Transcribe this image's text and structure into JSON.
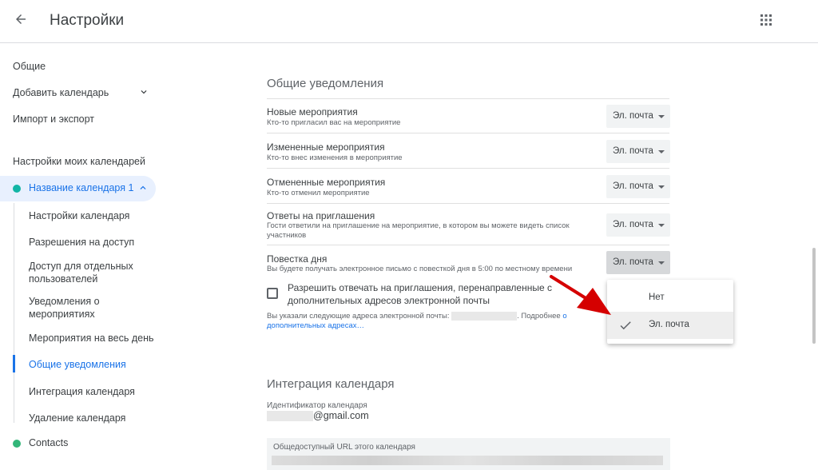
{
  "colors": {
    "accent": "#1a73e8",
    "calendar_dot": "#12b5a5",
    "contacts_dot": "#33b679",
    "annotation_arrow": "#d50000"
  },
  "header": {
    "title": "Настройки",
    "back_icon": "arrow-back-icon",
    "apps_icon": "apps-grid-icon"
  },
  "sidebar": {
    "general": "Общие",
    "add_calendar": "Добавить календарь",
    "import_export": "Импорт и экспорт",
    "my_calendars_heading": "Настройки моих календарей",
    "calendar_name": "Название календаря 1",
    "sub_items": [
      "Настройки календаря",
      "Разрешения на доступ",
      "Доступ для отдельных пользователей",
      "Уведомления о мероприятиях",
      "Мероприятия на весь день",
      "Общие уведомления",
      "Интеграция календаря",
      "Удаление календаря"
    ],
    "active_sub_item": "Общие уведомления",
    "contacts": "Contacts"
  },
  "notifications": {
    "section_title": "Общие уведомления",
    "rows": [
      {
        "title": "Новые мероприятия",
        "subtitle": "Кто-то пригласил вас на мероприятие",
        "value": "Эл. почта"
      },
      {
        "title": "Измененные мероприятия",
        "subtitle": "Кто-то внес изменения в мероприятие",
        "value": "Эл. почта"
      },
      {
        "title": "Отмененные мероприятия",
        "subtitle": "Кто-то отменил мероприятие",
        "value": "Эл. почта"
      },
      {
        "title": "Ответы на приглашения",
        "subtitle": "Гости ответили на приглашение на мероприятие, в котором вы можете видеть список участников",
        "value": "Эл. почта"
      },
      {
        "title": "Повестка дня",
        "subtitle": "Вы будете получать электронное письмо с повесткой дня в 5:00 по местному времени",
        "value": "Эл. почта"
      }
    ],
    "checkbox_label": "Разрешить отвечать на приглашения, перенаправленные с дополнительных адресов электронной почты",
    "email_note_prefix": "Вы указали следующие адреса электронной почты:",
    "email_note_more": ". Подробнее",
    "email_note_link": "о дополнительных адресах…"
  },
  "dropdown": {
    "options": [
      "Нет",
      "Эл. почта"
    ],
    "selected": "Эл. почта",
    "check_icon": "checkmark-icon"
  },
  "integration": {
    "section_title": "Интеграция календаря",
    "id_label": "Идентификатор календаря",
    "email_suffix": "@gmail.com",
    "public_url_label": "Общедоступный URL этого календаря"
  }
}
